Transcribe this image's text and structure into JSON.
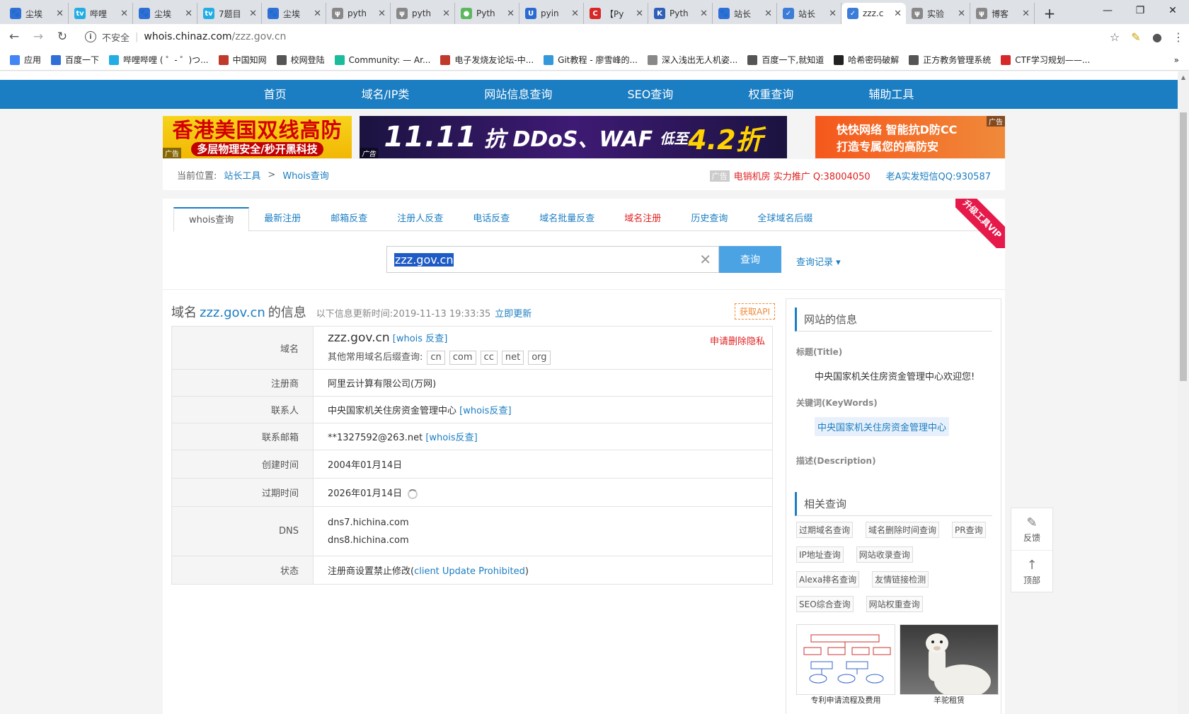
{
  "browser": {
    "tabs": [
      {
        "label": "尘埃",
        "color": "#2f6fd6",
        "glyph": "🐾"
      },
      {
        "label": "哔哩",
        "color": "#23ade5",
        "glyph": "tv"
      },
      {
        "label": "尘埃",
        "color": "#2f6fd6",
        "glyph": "🐾"
      },
      {
        "label": "7题目",
        "color": "#23ade5",
        "glyph": "tv"
      },
      {
        "label": "尘埃",
        "color": "#2f6fd6",
        "glyph": "🐾"
      },
      {
        "label": "pyth",
        "color": "#888888",
        "glyph": "ψ"
      },
      {
        "label": "pyth",
        "color": "#888888",
        "glyph": "ψ"
      },
      {
        "label": "Pyth",
        "color": "#5cb85c",
        "glyph": "●"
      },
      {
        "label": "pyin",
        "color": "#2a6ad1",
        "glyph": "U"
      },
      {
        "label": "【Py",
        "color": "#d62828",
        "glyph": "C"
      },
      {
        "label": "Pyth",
        "color": "#2f5fb8",
        "glyph": "K"
      },
      {
        "label": "站长",
        "color": "#2f6fd6",
        "glyph": "🐾"
      },
      {
        "label": "站长",
        "color": "#3b7dd8",
        "glyph": "✓"
      },
      {
        "label": "zzz.c",
        "color": "#3b7dd8",
        "glyph": "✓",
        "active": true
      },
      {
        "label": "实验",
        "color": "#888888",
        "glyph": "ψ"
      },
      {
        "label": "博客",
        "color": "#888888",
        "glyph": "ψ"
      }
    ],
    "url_insecure": "不安全",
    "url_host": "whois.chinaz.com",
    "url_path": "/zzz.gov.cn",
    "bookmarks": [
      {
        "label": "应用",
        "color": "#4285f4"
      },
      {
        "label": "百度一下",
        "color": "#2f6fd6"
      },
      {
        "label": "哔哩哔哩 ( ゜- ゜)つ...",
        "color": "#23ade5"
      },
      {
        "label": "中国知网",
        "color": "#c0392b"
      },
      {
        "label": "校网登陆",
        "color": "#555555"
      },
      {
        "label": "Community: — Ar...",
        "color": "#1abc9c"
      },
      {
        "label": "电子发烧友论坛-中...",
        "color": "#c0392b"
      },
      {
        "label": "Git教程 - 廖雪峰的...",
        "color": "#3498db"
      },
      {
        "label": "深入浅出无人机姿...",
        "color": "#888888"
      },
      {
        "label": "百度一下,就知道",
        "color": "#555555"
      },
      {
        "label": "哈希密码破解",
        "color": "#222222"
      },
      {
        "label": "正方教务管理系统",
        "color": "#555555"
      },
      {
        "label": "CTF学习规划——...",
        "color": "#d62828"
      }
    ]
  },
  "nav": [
    "首页",
    "域名/IP类",
    "网站信息查询",
    "SEO查询",
    "权重查询",
    "辅助工具"
  ],
  "ads": {
    "ad1_l1": "香港美国双线高防",
    "ad1_l2": "多层物理安全/秒开黑科技",
    "ad2_a": "11.11",
    "ad2_b": "抗 DDoS、WAF",
    "ad2_c": "低至",
    "ad2_d": "4.2折",
    "ad3_l1": "快快网络 智能抗D防CC",
    "ad3_l2": "打造专属您的高防安",
    "tag": "广告"
  },
  "breadcrumb": {
    "label": "当前位置:",
    "link": "站长工具",
    "sep": ">",
    "current": "Whois查询",
    "ad_tag": "广告",
    "promo_red": "电销机房 实力推广 Q:38004050",
    "promo_blue": "老A实发短信QQ:930587"
  },
  "subtabs": [
    "whois查询",
    "最新注册",
    "邮箱反查",
    "注册人反查",
    "电话反查",
    "域名批量反查",
    "域名注册",
    "历史查询",
    "全球域名后缀"
  ],
  "vip": "升级工具VIP",
  "search": {
    "value": "zzz.gov.cn",
    "button": "查询",
    "history": "查询记录 ▾"
  },
  "info_title": {
    "prefix": "域名",
    "domain": "zzz.gov.cn",
    "suffix": "的信息",
    "updated": "以下信息更新时间:2019-11-13 19:33:35",
    "update_now": "立即更新",
    "api": "获取API"
  },
  "whois": {
    "domain_label": "域名",
    "domain_value": "zzz.gov.cn",
    "domain_link": "[whois 反查]",
    "privacy": "申请删除隐私",
    "suffix_label": "其他常用域名后缀查询:",
    "suffixes": [
      "cn",
      "com",
      "cc",
      "net",
      "org"
    ],
    "registrar_label": "注册商",
    "registrar": "阿里云计算有限公司(万网)",
    "contact_label": "联系人",
    "contact": "中央国家机关住房资金管理中心",
    "contact_link": "[whois反查]",
    "email_label": "联系邮箱",
    "email": "**1327592@263.net",
    "email_link": "[whois反查]",
    "created_label": "创建时间",
    "created": "2004年01月14日",
    "expire_label": "过期时间",
    "expire": "2026年01月14日",
    "dns_label": "DNS",
    "dns1": "dns7.hichina.com",
    "dns2": "dns8.hichina.com",
    "status_label": "状态",
    "status_prefix": "注册商设置禁止修改(",
    "status_link": "client Update Prohibited",
    "status_suffix": ")"
  },
  "sidebar": {
    "site_info": "网站的信息",
    "title_label": "标题(Title)",
    "title_value": "中央国家机关住房资金管理中心欢迎您!",
    "keywords_label": "关键词(KeyWords)",
    "keywords_value": "中央国家机关住房资金管理中心",
    "desc_label": "描述(Description)",
    "related": "相关查询",
    "related_items": [
      "过期域名查询",
      "域名删除时间查询",
      "PR查询",
      "IP地址查询",
      "网站收录查询",
      "Alexa排名查询",
      "友情链接检测",
      "SEO综合查询",
      "网站权重查询"
    ],
    "thumb1": "专利申请流程及费用",
    "thumb2": "羊驼租赁"
  },
  "float": {
    "feedback": "反馈",
    "top": "顶部"
  }
}
